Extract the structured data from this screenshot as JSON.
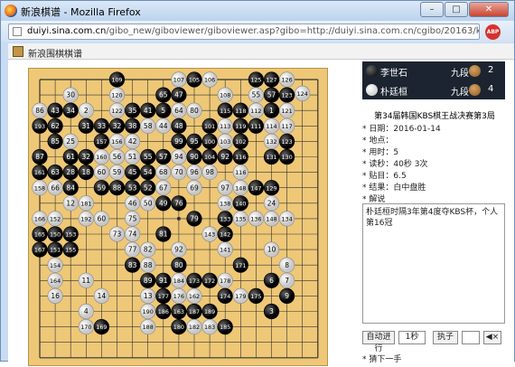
{
  "window": {
    "title": "新浪棋谱 - Mozilla Firefox",
    "min": "–",
    "max": "□",
    "close": "✕"
  },
  "address": {
    "domain": "duiyi.sina.com.cn",
    "path": "/gibo_new/giboviewer/giboviewer.asp?gibo=http://duiyi.sina.com.cn/cgibo/20163/kbs34f3-0114lsd.sg"
  },
  "addon_label": "ABP",
  "header_title": "新浪围棋棋谱",
  "players": [
    {
      "stone": "black",
      "name": "李世石",
      "rank": "九段",
      "captures": "2"
    },
    {
      "stone": "white",
      "name": "朴廷桓",
      "rank": "九段",
      "captures": "4"
    }
  ],
  "game_title": "第34届韩国KBS棋王战决赛第3局",
  "info": [
    {
      "label": "日期：",
      "value": "2016-01-14"
    },
    {
      "label": "地点：",
      "value": ""
    },
    {
      "label": "用时：",
      "value": "5"
    },
    {
      "label": "读秒：",
      "value": "40秒  3次"
    },
    {
      "label": "贴目：",
      "value": "6.5"
    },
    {
      "label": "结果：",
      "value": "白中盘胜"
    }
  ],
  "commentary_label": "解说",
  "commentary_text": "朴廷桓时隔3年第4度夺KBS杯，个人第16冠",
  "controls": {
    "autoplay": "自动进行",
    "interval": "1秒",
    "stone_btn": "执子",
    "mute": "◀×"
  },
  "next_label": "猜下一手",
  "colors": {
    "board": "#eec877",
    "panel_bar": "#1b2430"
  },
  "stones": [
    {
      "c": "b",
      "n": "109",
      "x": 5,
      "y": 0
    },
    {
      "c": "w",
      "n": "107",
      "x": 9,
      "y": 0
    },
    {
      "c": "b",
      "n": "105",
      "x": 10,
      "y": 0
    },
    {
      "c": "w",
      "n": "106",
      "x": 11,
      "y": 0
    },
    {
      "c": "b",
      "n": "125",
      "x": 14,
      "y": 0
    },
    {
      "c": "b",
      "n": "127",
      "x": 15,
      "y": 0
    },
    {
      "c": "w",
      "n": "126",
      "x": 16,
      "y": 0
    },
    {
      "c": "w",
      "n": "124",
      "x": 17,
      "y": 0.9
    },
    {
      "c": "w",
      "n": "30",
      "x": 2,
      "y": 1
    },
    {
      "c": "w",
      "n": "120",
      "x": 5,
      "y": 1
    },
    {
      "c": "b",
      "n": "65",
      "x": 8,
      "y": 1
    },
    {
      "c": "b",
      "n": "47",
      "x": 9,
      "y": 1
    },
    {
      "c": "w",
      "n": "108",
      "x": 12,
      "y": 1
    },
    {
      "c": "w",
      "n": "55",
      "x": 14,
      "y": 1
    },
    {
      "c": "b",
      "n": "57",
      "x": 15,
      "y": 1
    },
    {
      "c": "b",
      "n": "123",
      "x": 16,
      "y": 1
    },
    {
      "c": "w",
      "n": "86",
      "x": 0,
      "y": 2
    },
    {
      "c": "b",
      "n": "43",
      "x": 1,
      "y": 2
    },
    {
      "c": "b",
      "n": "34",
      "x": 2,
      "y": 2
    },
    {
      "c": "w",
      "n": "2",
      "x": 3,
      "y": 2
    },
    {
      "c": "w",
      "n": "122",
      "x": 5,
      "y": 2
    },
    {
      "c": "b",
      "n": "35",
      "x": 6,
      "y": 2
    },
    {
      "c": "b",
      "n": "41",
      "x": 7,
      "y": 2
    },
    {
      "c": "b",
      "n": "5",
      "x": 8,
      "y": 2
    },
    {
      "c": "w",
      "n": "64",
      "x": 9,
      "y": 2
    },
    {
      "c": "w",
      "n": "80",
      "x": 10,
      "y": 2
    },
    {
      "c": "b",
      "n": "115",
      "x": 12,
      "y": 2
    },
    {
      "c": "b",
      "n": "118",
      "x": 13,
      "y": 2
    },
    {
      "c": "w",
      "n": "112",
      "x": 14,
      "y": 2
    },
    {
      "c": "b",
      "n": "1",
      "x": 15,
      "y": 2
    },
    {
      "c": "w",
      "n": "121",
      "x": 16,
      "y": 2
    },
    {
      "c": "b",
      "n": "193",
      "x": 0,
      "y": 3
    },
    {
      "c": "b",
      "n": "62",
      "x": 1,
      "y": 3
    },
    {
      "c": "b",
      "n": "31",
      "x": 3,
      "y": 3
    },
    {
      "c": "b",
      "n": "33",
      "x": 4,
      "y": 3
    },
    {
      "c": "b",
      "n": "32",
      "x": 5,
      "y": 3
    },
    {
      "c": "b",
      "n": "38",
      "x": 6,
      "y": 3
    },
    {
      "c": "w",
      "n": "58",
      "x": 7,
      "y": 3
    },
    {
      "c": "w",
      "n": "44",
      "x": 8,
      "y": 3
    },
    {
      "c": "b",
      "n": "48",
      "x": 9,
      "y": 3
    },
    {
      "c": "b",
      "n": "101",
      "x": 11,
      "y": 3
    },
    {
      "c": "w",
      "n": "113",
      "x": 12,
      "y": 3
    },
    {
      "c": "b",
      "n": "119",
      "x": 13,
      "y": 3
    },
    {
      "c": "b",
      "n": "111",
      "x": 14,
      "y": 3
    },
    {
      "c": "w",
      "n": "114",
      "x": 15,
      "y": 3
    },
    {
      "c": "w",
      "n": "117",
      "x": 16,
      "y": 3
    },
    {
      "c": "b",
      "n": "85",
      "x": 1,
      "y": 4
    },
    {
      "c": "w",
      "n": "25",
      "x": 2,
      "y": 4
    },
    {
      "c": "b",
      "n": "157",
      "x": 4,
      "y": 4
    },
    {
      "c": "w",
      "n": "156",
      "x": 5,
      "y": 4
    },
    {
      "c": "w",
      "n": "42",
      "x": 6,
      "y": 4
    },
    {
      "c": "b",
      "n": "99",
      "x": 9,
      "y": 4
    },
    {
      "c": "b",
      "n": "95",
      "x": 10,
      "y": 4
    },
    {
      "c": "b",
      "n": "100",
      "x": 11,
      "y": 4
    },
    {
      "c": "w",
      "n": "103",
      "x": 12,
      "y": 4
    },
    {
      "c": "b",
      "n": "102",
      "x": 13,
      "y": 4
    },
    {
      "c": "w",
      "n": "132",
      "x": 15,
      "y": 4
    },
    {
      "c": "b",
      "n": "123",
      "x": 16,
      "y": 4
    },
    {
      "c": "b",
      "n": "87",
      "x": 0,
      "y": 5
    },
    {
      "c": "b",
      "n": "61",
      "x": 2,
      "y": 5
    },
    {
      "c": "b",
      "n": "32",
      "x": 3,
      "y": 5
    },
    {
      "c": "w",
      "n": "160",
      "x": 4,
      "y": 5
    },
    {
      "c": "w",
      "n": "56",
      "x": 5,
      "y": 5
    },
    {
      "c": "w",
      "n": "51",
      "x": 6,
      "y": 5
    },
    {
      "c": "b",
      "n": "55",
      "x": 7,
      "y": 5
    },
    {
      "c": "b",
      "n": "57",
      "x": 8,
      "y": 5
    },
    {
      "c": "w",
      "n": "94",
      "x": 9,
      "y": 5
    },
    {
      "c": "b",
      "n": "90",
      "x": 10,
      "y": 5
    },
    {
      "c": "b",
      "n": "104",
      "x": 11,
      "y": 5
    },
    {
      "c": "b",
      "n": "92",
      "x": 12,
      "y": 5
    },
    {
      "c": "b",
      "n": "116",
      "x": 13,
      "y": 5
    },
    {
      "c": "b",
      "n": "131",
      "x": 15,
      "y": 5
    },
    {
      "c": "b",
      "n": "130",
      "x": 16,
      "y": 5
    },
    {
      "c": "b",
      "n": "161",
      "x": 0,
      "y": 6
    },
    {
      "c": "b",
      "n": "63",
      "x": 1,
      "y": 6
    },
    {
      "c": "b",
      "n": "28",
      "x": 2,
      "y": 6
    },
    {
      "c": "b",
      "n": "18",
      "x": 3,
      "y": 6
    },
    {
      "c": "w",
      "n": "60",
      "x": 4,
      "y": 6
    },
    {
      "c": "w",
      "n": "59",
      "x": 5,
      "y": 6
    },
    {
      "c": "b",
      "n": "45",
      "x": 6,
      "y": 6
    },
    {
      "c": "b",
      "n": "54",
      "x": 7,
      "y": 6
    },
    {
      "c": "w",
      "n": "68",
      "x": 8,
      "y": 6
    },
    {
      "c": "w",
      "n": "70",
      "x": 9,
      "y": 6
    },
    {
      "c": "w",
      "n": "96",
      "x": 10,
      "y": 6
    },
    {
      "c": "w",
      "n": "98",
      "x": 11,
      "y": 6
    },
    {
      "c": "w",
      "n": "116",
      "x": 13,
      "y": 6
    },
    {
      "c": "w",
      "n": "158",
      "x": 0,
      "y": 7
    },
    {
      "c": "w",
      "n": "66",
      "x": 1,
      "y": 7
    },
    {
      "c": "b",
      "n": "84",
      "x": 2,
      "y": 7
    },
    {
      "c": "b",
      "n": "59",
      "x": 4,
      "y": 7
    },
    {
      "c": "b",
      "n": "88",
      "x": 5,
      "y": 7
    },
    {
      "c": "b",
      "n": "53",
      "x": 6,
      "y": 7
    },
    {
      "c": "b",
      "n": "52",
      "x": 7,
      "y": 7
    },
    {
      "c": "w",
      "n": "67",
      "x": 8,
      "y": 7
    },
    {
      "c": "w",
      "n": "69",
      "x": 10,
      "y": 7
    },
    {
      "c": "w",
      "n": "97",
      "x": 12,
      "y": 7
    },
    {
      "c": "w",
      "n": "148",
      "x": 13,
      "y": 7
    },
    {
      "c": "b",
      "n": "147",
      "x": 14,
      "y": 7
    },
    {
      "c": "b",
      "n": "129",
      "x": 15,
      "y": 7
    },
    {
      "c": "w",
      "n": "12",
      "x": 2,
      "y": 8
    },
    {
      "c": "w",
      "n": "181",
      "x": 3,
      "y": 8
    },
    {
      "c": "w",
      "n": "46",
      "x": 6,
      "y": 8
    },
    {
      "c": "w",
      "n": "50",
      "x": 7,
      "y": 8
    },
    {
      "c": "b",
      "n": "49",
      "x": 8,
      "y": 8
    },
    {
      "c": "b",
      "n": "76",
      "x": 9,
      "y": 8
    },
    {
      "c": "w",
      "n": "138",
      "x": 12,
      "y": 8
    },
    {
      "c": "b",
      "n": "140",
      "x": 13,
      "y": 8
    },
    {
      "c": "w",
      "n": "24",
      "x": 15,
      "y": 8
    },
    {
      "c": "w",
      "n": "166",
      "x": 0,
      "y": 9
    },
    {
      "c": "w",
      "n": "152",
      "x": 1,
      "y": 9
    },
    {
      "c": "w",
      "n": "192",
      "x": 3,
      "y": 9
    },
    {
      "c": "w",
      "n": "60",
      "x": 4,
      "y": 9
    },
    {
      "c": "w",
      "n": "75",
      "x": 6,
      "y": 9
    },
    {
      "c": "b",
      "n": "79",
      "x": 10,
      "y": 9
    },
    {
      "c": "b",
      "n": "133",
      "x": 12,
      "y": 9
    },
    {
      "c": "w",
      "n": "135",
      "x": 13,
      "y": 9
    },
    {
      "c": "w",
      "n": "136",
      "x": 14,
      "y": 9
    },
    {
      "c": "w",
      "n": "148",
      "x": 15,
      "y": 9
    },
    {
      "c": "w",
      "n": "134",
      "x": 16,
      "y": 9
    },
    {
      "c": "b",
      "n": "165",
      "x": 0,
      "y": 10
    },
    {
      "c": "b",
      "n": "150",
      "x": 1,
      "y": 10
    },
    {
      "c": "b",
      "n": "153",
      "x": 2,
      "y": 10
    },
    {
      "c": "w",
      "n": "73",
      "x": 5,
      "y": 10
    },
    {
      "c": "w",
      "n": "74",
      "x": 6,
      "y": 10
    },
    {
      "c": "b",
      "n": "81",
      "x": 8,
      "y": 10
    },
    {
      "c": "w",
      "n": "143",
      "x": 11,
      "y": 10
    },
    {
      "c": "b",
      "n": "142",
      "x": 12,
      "y": 10
    },
    {
      "c": "b",
      "n": "167",
      "x": 0,
      "y": 11
    },
    {
      "c": "b",
      "n": "151",
      "x": 1,
      "y": 11
    },
    {
      "c": "b",
      "n": "155",
      "x": 2,
      "y": 11
    },
    {
      "c": "w",
      "n": "77",
      "x": 6,
      "y": 11
    },
    {
      "c": "w",
      "n": "82",
      "x": 7,
      "y": 11
    },
    {
      "c": "w",
      "n": "92",
      "x": 9,
      "y": 11
    },
    {
      "c": "w",
      "n": "141",
      "x": 12,
      "y": 11
    },
    {
      "c": "w",
      "n": "10",
      "x": 15,
      "y": 11
    },
    {
      "c": "w",
      "n": "154",
      "x": 1,
      "y": 12
    },
    {
      "c": "b",
      "n": "83",
      "x": 6,
      "y": 12
    },
    {
      "c": "w",
      "n": "88",
      "x": 7,
      "y": 12
    },
    {
      "c": "b",
      "n": "80",
      "x": 9,
      "y": 12
    },
    {
      "c": "b",
      "n": "171",
      "x": 13,
      "y": 12
    },
    {
      "c": "w",
      "n": "8",
      "x": 16,
      "y": 12
    },
    {
      "c": "w",
      "n": "164",
      "x": 1,
      "y": 13
    },
    {
      "c": "w",
      "n": "11",
      "x": 3,
      "y": 13
    },
    {
      "c": "b",
      "n": "89",
      "x": 7,
      "y": 13
    },
    {
      "c": "b",
      "n": "91",
      "x": 8,
      "y": 13
    },
    {
      "c": "w",
      "n": "184",
      "x": 9,
      "y": 13
    },
    {
      "c": "b",
      "n": "173",
      "x": 10,
      "y": 13
    },
    {
      "c": "b",
      "n": "172",
      "x": 11,
      "y": 13
    },
    {
      "c": "w",
      "n": "178",
      "x": 12,
      "y": 13
    },
    {
      "c": "b",
      "n": "6",
      "x": 15,
      "y": 13
    },
    {
      "c": "w",
      "n": "7",
      "x": 16,
      "y": 13
    },
    {
      "c": "w",
      "n": "16",
      "x": 1,
      "y": 14
    },
    {
      "c": "w",
      "n": "14",
      "x": 4,
      "y": 14
    },
    {
      "c": "w",
      "n": "13",
      "x": 7,
      "y": 14
    },
    {
      "c": "b",
      "n": "177",
      "x": 8,
      "y": 14
    },
    {
      "c": "w",
      "n": "176",
      "x": 9,
      "y": 14
    },
    {
      "c": "w",
      "n": "162",
      "x": 10,
      "y": 14
    },
    {
      "c": "b",
      "n": "174",
      "x": 12,
      "y": 14
    },
    {
      "c": "w",
      "n": "179",
      "x": 13,
      "y": 14
    },
    {
      "c": "b",
      "n": "175",
      "x": 14,
      "y": 14
    },
    {
      "c": "b",
      "n": "9",
      "x": 16,
      "y": 14
    },
    {
      "c": "w",
      "n": "4",
      "x": 3,
      "y": 15
    },
    {
      "c": "w",
      "n": "190",
      "x": 7,
      "y": 15
    },
    {
      "c": "b",
      "n": "186",
      "x": 8,
      "y": 15
    },
    {
      "c": "b",
      "n": "163",
      "x": 9,
      "y": 15
    },
    {
      "c": "b",
      "n": "187",
      "x": 10,
      "y": 15
    },
    {
      "c": "b",
      "n": "189",
      "x": 11,
      "y": 15
    },
    {
      "c": "b",
      "n": "3",
      "x": 15,
      "y": 15
    },
    {
      "c": "w",
      "n": "170",
      "x": 3,
      "y": 16
    },
    {
      "c": "b",
      "n": "169",
      "x": 4,
      "y": 16
    },
    {
      "c": "w",
      "n": "188",
      "x": 7,
      "y": 16
    },
    {
      "c": "b",
      "n": "180",
      "x": 9,
      "y": 16
    },
    {
      "c": "w",
      "n": "182",
      "x": 10,
      "y": 16
    },
    {
      "c": "w",
      "n": "183",
      "x": 11,
      "y": 16
    },
    {
      "c": "b",
      "n": "185",
      "x": 12,
      "y": 16
    }
  ]
}
